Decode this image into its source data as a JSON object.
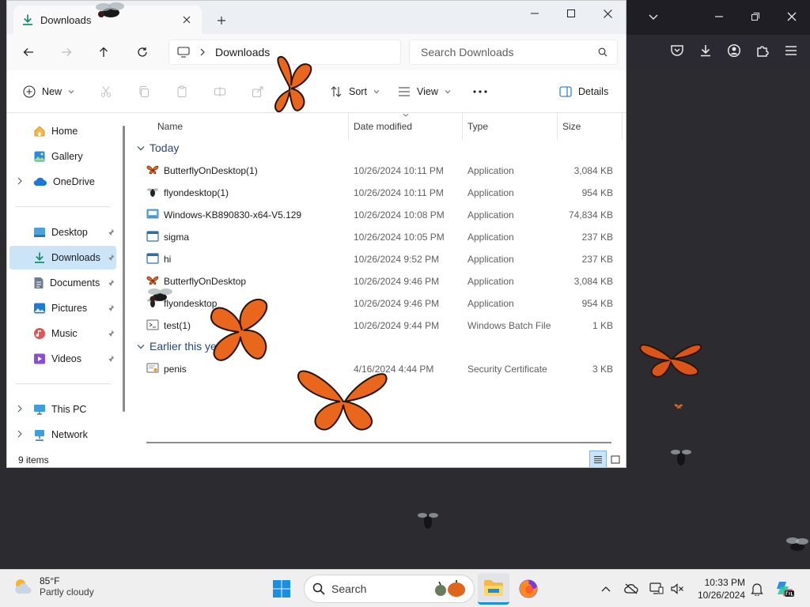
{
  "explorer": {
    "tab_title": "Downloads",
    "tab_icon": "download-icon",
    "path": "Downloads",
    "search_placeholder": "Search Downloads",
    "commands": {
      "new": "New",
      "sort": "Sort",
      "view": "View",
      "details": "Details"
    },
    "nav": {
      "top": [
        "Home",
        "Gallery",
        "OneDrive"
      ],
      "pinned": [
        "Desktop",
        "Downloads",
        "Documents",
        "Pictures",
        "Music",
        "Videos"
      ],
      "bottom": [
        "This PC",
        "Network"
      ],
      "selected": "Downloads"
    },
    "columns": {
      "name": "Name",
      "date": "Date modified",
      "type": "Type",
      "size": "Size"
    },
    "groups": {
      "today": "Today",
      "earlier": "Earlier this year"
    },
    "files": [
      {
        "name": "ButterflyOnDesktop(1)",
        "date": "10/26/2024 10:11 PM",
        "type": "Application",
        "size": "3,084 KB",
        "icon": "butterfly-app-icon"
      },
      {
        "name": "flyondesktop(1)",
        "date": "10/26/2024 10:11 PM",
        "type": "Application",
        "size": "954 KB",
        "icon": "fly-app-icon"
      },
      {
        "name": "Windows-KB890830-x64-V5.129",
        "date": "10/26/2024 10:08 PM",
        "type": "Application",
        "size": "74,834 KB",
        "icon": "installer-icon"
      },
      {
        "name": "sigma",
        "date": "10/26/2024 10:05 PM",
        "type": "Application",
        "size": "237 KB",
        "icon": "app-window-icon"
      },
      {
        "name": "hi",
        "date": "10/26/2024 9:52 PM",
        "type": "Application",
        "size": "237 KB",
        "icon": "app-window-icon"
      },
      {
        "name": "ButterflyOnDesktop",
        "date": "10/26/2024 9:46 PM",
        "type": "Application",
        "size": "3,084 KB",
        "icon": "butterfly-app-icon"
      },
      {
        "name": "flyondesktop",
        "date": "10/26/2024 9:46 PM",
        "type": "Application",
        "size": "954 KB",
        "icon": "fly-app-icon"
      },
      {
        "name": "test(1)",
        "date": "10/26/2024 9:44 PM",
        "type": "Windows Batch File",
        "size": "1 KB",
        "icon": "batch-file-icon"
      }
    ],
    "earlier_files": [
      {
        "name": "penis",
        "date": "4/16/2024 4:44 PM",
        "type": "Security Certificate",
        "size": "3 KB",
        "icon": "certificate-icon"
      }
    ],
    "status": "9 items"
  },
  "taskbar": {
    "weather_temp": "85°F",
    "weather_desc": "Partly cloudy",
    "search_label": "Search",
    "time": "10:33 PM",
    "date": "10/26/2024"
  },
  "colors": {
    "desktop": "#2b2b30",
    "selection": "#cce4f7",
    "group_header": "#27477a",
    "butterfly": "#e9661d"
  }
}
